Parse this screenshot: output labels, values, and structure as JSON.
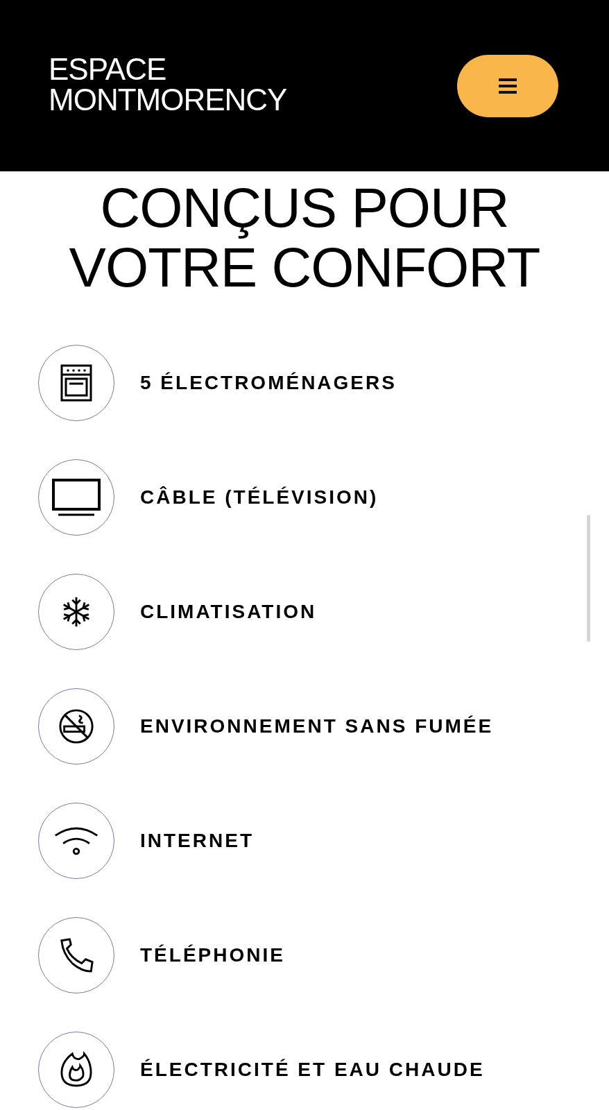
{
  "header": {
    "logo_lines": [
      "ESPACE",
      "MONTMORENCY"
    ]
  },
  "heading": "CONÇUS POUR VOTRE CONFORT",
  "amenities": [
    {
      "label": "5 ÉLECTROMÉNAGERS"
    },
    {
      "label": "CÂBLE (TÉLÉVISION)"
    },
    {
      "label": "CLIMATISATION"
    },
    {
      "label": "ENVIRONNEMENT SANS FUMÉE"
    },
    {
      "label": "INTERNET"
    },
    {
      "label": "TÉLÉPHONIE"
    },
    {
      "label": "ÉLECTRICITÉ ET EAU CHAUDE"
    }
  ]
}
